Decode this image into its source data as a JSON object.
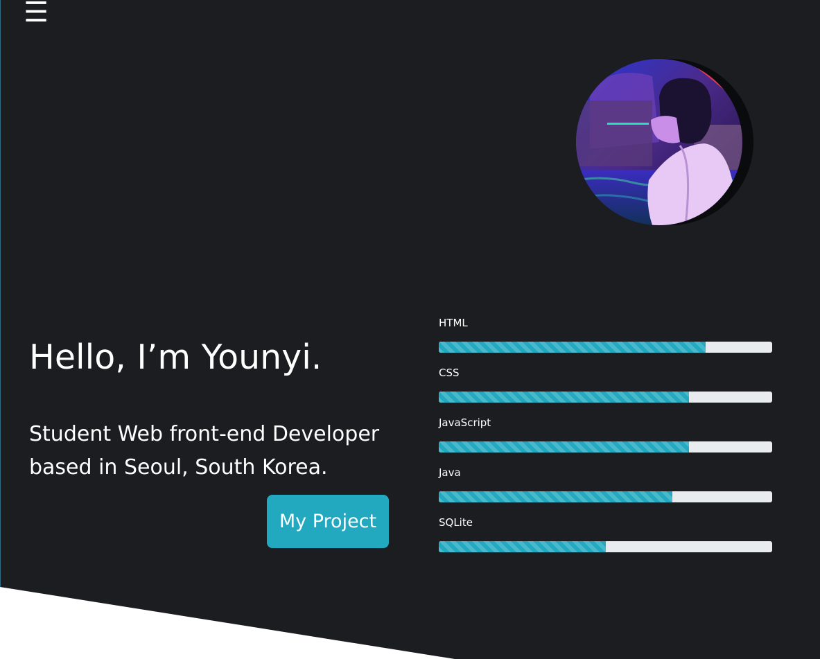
{
  "nav": {
    "menu_icon": "hamburger-menu-icon",
    "menu_glyph": "☰"
  },
  "hero": {
    "greeting": "Hello, I’m Younyi.",
    "tagline": "Student Web front-end Developer based in Seoul, South Korea.",
    "project_button": "My Project"
  },
  "skills": [
    {
      "label": "HTML",
      "percent": 80
    },
    {
      "label": "CSS",
      "percent": 75
    },
    {
      "label": "JavaScript",
      "percent": 75
    },
    {
      "label": "Java",
      "percent": 70
    },
    {
      "label": "SQLite",
      "percent": 50
    }
  ],
  "colors": {
    "background": "#1b1d21",
    "accent": "#22a9c0",
    "track": "#e9ecef",
    "text": "#ffffff"
  }
}
